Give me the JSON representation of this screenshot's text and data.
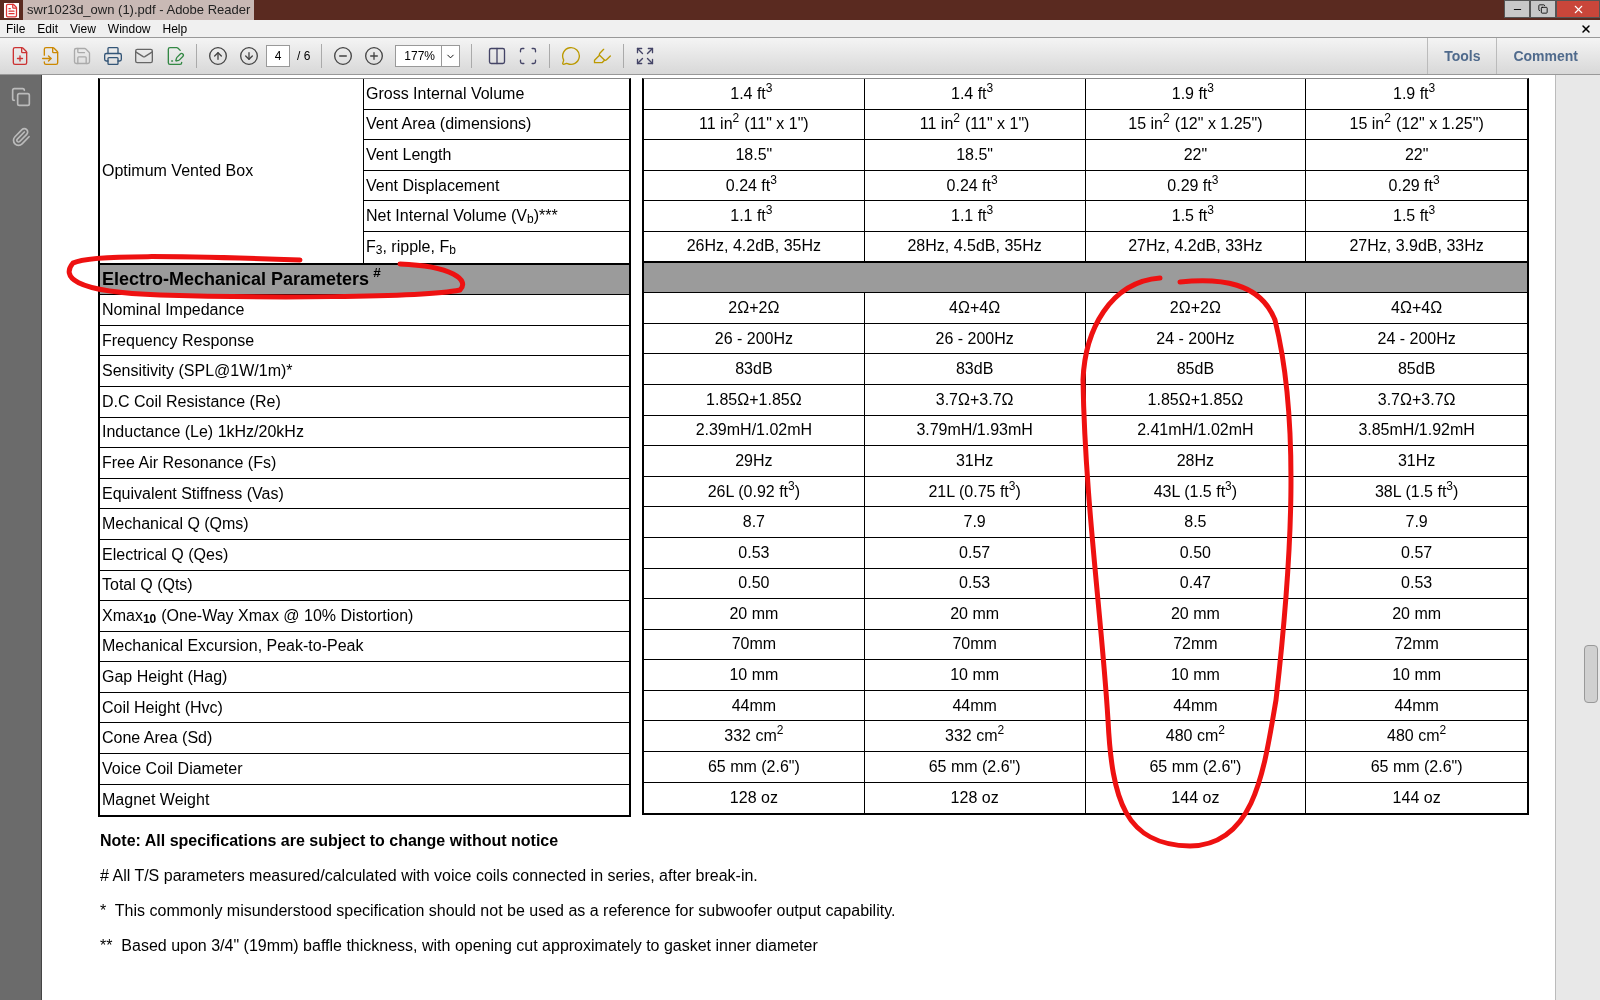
{
  "window": {
    "title": "swr1023d_own (1).pdf - Adobe Reader"
  },
  "menu": [
    "File",
    "Edit",
    "View",
    "Window",
    "Help"
  ],
  "toolbar": {
    "page": "4",
    "page_count": "/ 6",
    "zoom": "177%",
    "panes": [
      {
        "label": "Tools",
        "selected": false
      },
      {
        "label": "Comment",
        "selected": false
      }
    ]
  },
  "vented_box": {
    "label": "Optimum Vented Box",
    "rows": [
      {
        "name": "Gross Internal Volume",
        "values": [
          "1.4 ft$^{3}$",
          "1.4 ft$^{3}$",
          "1.9 ft$^{3}$",
          "1.9 ft$^{3}$"
        ]
      },
      {
        "name": "Vent Area (dimensions)",
        "values": [
          "11 in$^{2}$ (11\" x 1\")",
          "11 in$^{2}$ (11\" x 1\")",
          "15 in$^{2}$ (12\" x 1.25\")",
          "15 in$^{2}$ (12\" x 1.25\")"
        ]
      },
      {
        "name": "Vent Length",
        "values": [
          "18.5\"",
          "18.5\"",
          "22\"",
          "22\""
        ]
      },
      {
        "name": "Vent Displacement",
        "values": [
          "0.24 ft$^{3}$",
          "0.24 ft$^{3}$",
          "0.29 ft$^{3}$",
          "0.29 ft$^{3}$"
        ]
      },
      {
        "name": "Net Internal Volume (V$_{b}$)***",
        "values": [
          "1.1 ft$^{3}$",
          "1.1 ft$^{3}$",
          "1.5 ft$^{3}$",
          "1.5 ft$^{3}$"
        ]
      },
      {
        "name": "F$_{3}$, ripple, F$_{b}$",
        "values": [
          "26Hz, 4.2dB, 35Hz",
          "28Hz, 4.5dB, 35Hz",
          "27Hz, 4.2dB, 33Hz",
          "27Hz, 3.9dB, 33Hz"
        ]
      }
    ]
  },
  "section": {
    "title": "Electro-Mechanical Parameters $^{#}$"
  },
  "parameters": [
    {
      "name": "Nominal Impedance",
      "values": [
        "2Ω+2Ω",
        "4Ω+4Ω",
        "2Ω+2Ω",
        "4Ω+4Ω"
      ]
    },
    {
      "name": "Frequency Response",
      "values": [
        "26 - 200Hz",
        "26 - 200Hz",
        "24 - 200Hz",
        "24 - 200Hz"
      ]
    },
    {
      "name": "Sensitivity (SPL@1W/1m)*",
      "values": [
        "83dB",
        "83dB",
        "85dB",
        "85dB"
      ]
    },
    {
      "name": "D.C Coil Resistance (Re)",
      "values": [
        "1.85Ω+1.85Ω",
        "3.7Ω+3.7Ω",
        "1.85Ω+1.85Ω",
        "3.7Ω+3.7Ω"
      ]
    },
    {
      "name": "Inductance (Le) 1kHz/20kHz",
      "values": [
        "2.39mH/1.02mH",
        "3.79mH/1.93mH",
        "2.41mH/1.02mH",
        "3.85mH/1.92mH"
      ]
    },
    {
      "name": "Free Air Resonance (Fs)",
      "values": [
        "29Hz",
        "31Hz",
        "28Hz",
        "31Hz"
      ]
    },
    {
      "name": "Equivalent Stiffness (Vas)",
      "values": [
        "26L (0.92 ft$^{3}$)",
        "21L (0.75 ft$^{3}$)",
        "43L (1.5 ft$^{3}$)",
        "38L (1.5 ft$^{3}$)"
      ]
    },
    {
      "name": "Mechanical Q (Qms)",
      "values": [
        "8.7",
        "7.9",
        "8.5",
        "7.9"
      ]
    },
    {
      "name": "Electrical Q (Qes)",
      "values": [
        "0.53",
        "0.57",
        "0.50",
        "0.57"
      ]
    },
    {
      "name": "Total Q (Qts)",
      "values": [
        "0.50",
        "0.53",
        "0.47",
        "0.53"
      ]
    },
    {
      "name": "Xmax$_{10}$ (One-Way Xmax @ 10% Distortion)",
      "values": [
        "20 mm",
        "20 mm",
        "20 mm",
        "20 mm"
      ]
    },
    {
      "name": "Mechanical Excursion, Peak-to-Peak",
      "values": [
        "70mm",
        "70mm",
        "72mm",
        "72mm"
      ]
    },
    {
      "name": "Gap Height (Hag)",
      "values": [
        "10 mm",
        "10 mm",
        "10 mm",
        "10 mm"
      ]
    },
    {
      "name": "Coil Height (Hvc)",
      "values": [
        "44mm",
        "44mm",
        "44mm",
        "44mm"
      ]
    },
    {
      "name": "Cone Area (Sd)",
      "values": [
        "332 cm$^{2}$",
        "332 cm$^{2}$",
        "480 cm$^{2}$",
        "480 cm$^{2}$"
      ]
    },
    {
      "name": "Voice Coil Diameter",
      "values": [
        "65 mm (2.6\")",
        "65 mm (2.6\")",
        "65 mm (2.6\")",
        "65 mm (2.6\")"
      ]
    },
    {
      "name": "Magnet Weight",
      "values": [
        "128 oz",
        "128 oz",
        "144 oz",
        "144 oz"
      ]
    }
  ],
  "notes": [
    {
      "kind": "bold",
      "text": "Note: All specifications are subject to change without notice"
    },
    {
      "kind": "plain",
      "text": "# All T/S parameters measured/calculated with voice coils connected in series, after break-in."
    },
    {
      "kind": "plain",
      "text": "*  This commonly misunderstood specification should not be used as a reference for subwoofer output capability."
    },
    {
      "kind": "plain",
      "text": "**  Based upon 3/4\" (19mm) baffle thickness, with opening cut approximately to gasket inner diameter"
    }
  ]
}
